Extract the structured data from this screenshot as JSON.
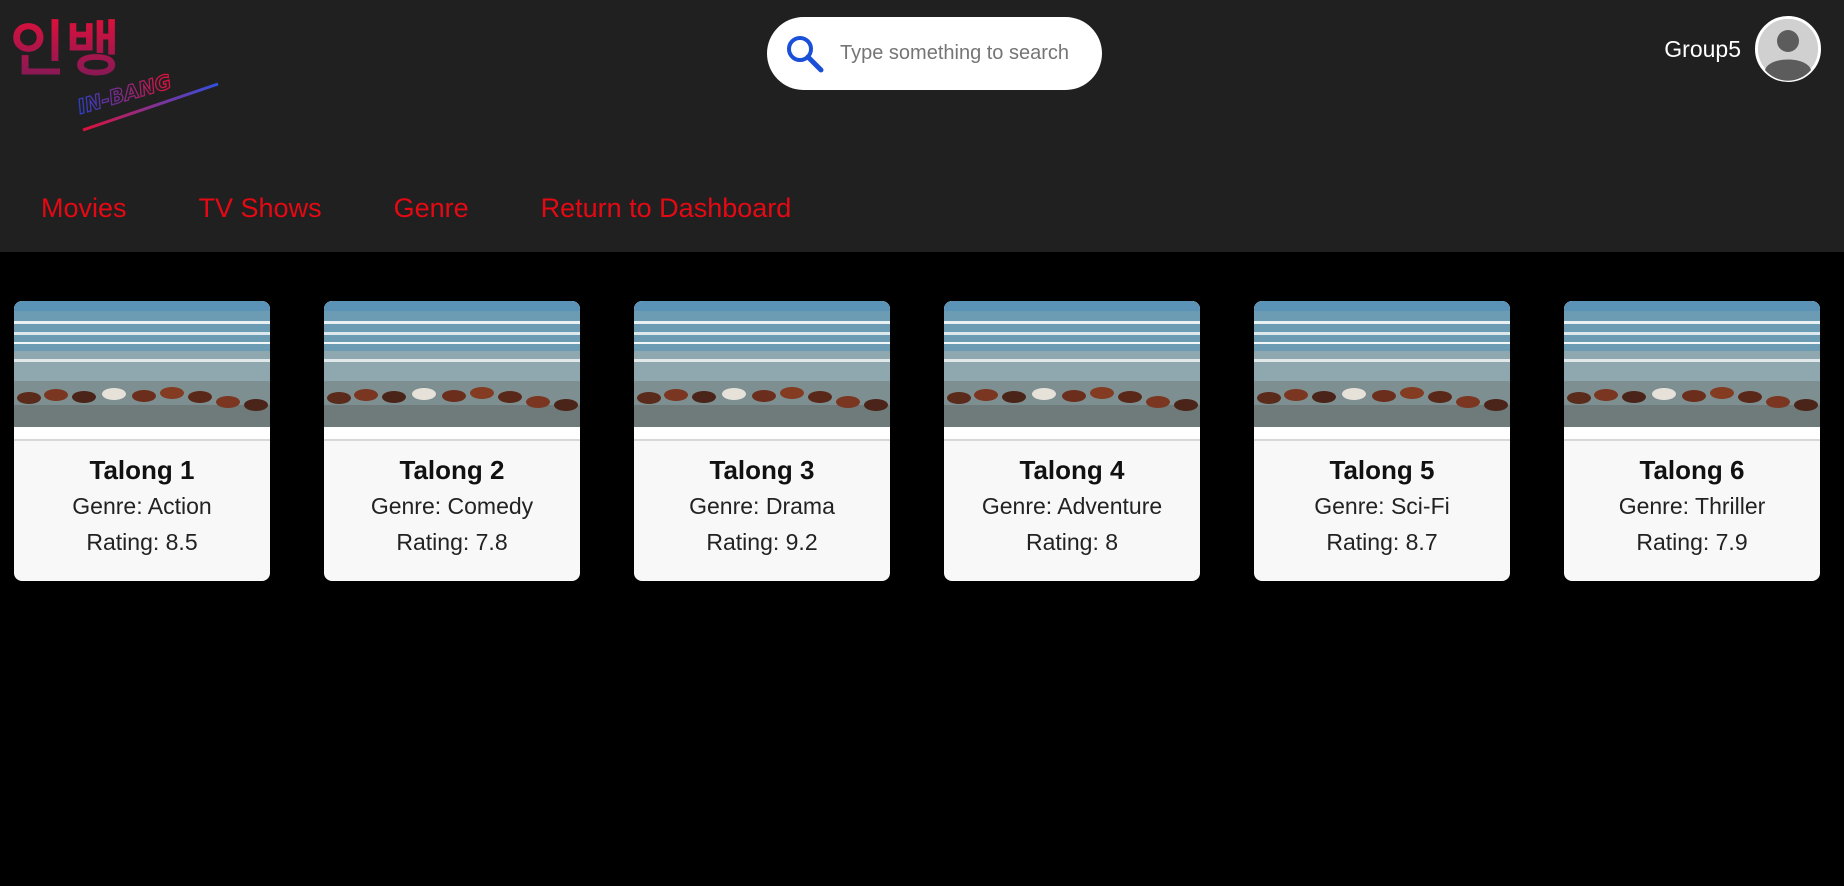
{
  "logo": {
    "korean_text": "인뱅",
    "latin_text": "IN-BANG"
  },
  "search": {
    "placeholder": "Type something to search",
    "value": "",
    "icon": "search-icon"
  },
  "user": {
    "name": "Group5",
    "icon": "user-avatar-icon"
  },
  "nav": {
    "items": [
      {
        "label": "Movies"
      },
      {
        "label": "TV Shows"
      },
      {
        "label": "Genre"
      },
      {
        "label": "Return to Dashboard"
      }
    ]
  },
  "cards": [
    {
      "title": "Talong 1",
      "genre_label": "Genre:",
      "genre": "Action",
      "rating_label": "Rating:",
      "rating": "8.5"
    },
    {
      "title": "Talong 2",
      "genre_label": "Genre:",
      "genre": "Comedy",
      "rating_label": "Rating:",
      "rating": "7.8"
    },
    {
      "title": "Talong 3",
      "genre_label": "Genre:",
      "genre": "Drama",
      "rating_label": "Rating:",
      "rating": "9.2"
    },
    {
      "title": "Talong 4",
      "genre_label": "Genre:",
      "genre": "Adventure",
      "rating_label": "Rating:",
      "rating": "8"
    },
    {
      "title": "Talong 5",
      "genre_label": "Genre:",
      "genre": "Sci-Fi",
      "rating_label": "Rating:",
      "rating": "8.7"
    },
    {
      "title": "Talong 6",
      "genre_label": "Genre:",
      "genre": "Thriller",
      "rating_label": "Rating:",
      "rating": "7.9"
    }
  ],
  "colors": {
    "header_bg": "#202020",
    "page_bg": "#000000",
    "nav_accent": "#e50914",
    "search_icon": "#1a4fd8"
  }
}
